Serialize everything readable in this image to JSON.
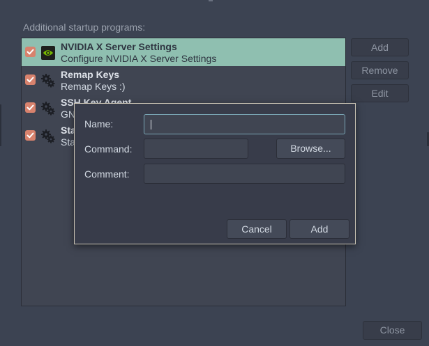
{
  "window": {
    "section_label": "Additional startup programs:",
    "buttons": {
      "add": "Add",
      "remove": "Remove",
      "edit": "Edit",
      "close": "Close"
    }
  },
  "programs": [
    {
      "title": "NVIDIA X Server Settings",
      "subtitle": "Configure NVIDIA X Server Settings",
      "checked": true,
      "selected": true,
      "icon": "nvidia-icon"
    },
    {
      "title": "Remap Keys",
      "subtitle": "Remap Keys :)",
      "checked": true,
      "selected": false,
      "icon": "gears-icon"
    },
    {
      "title": "SSH Key Agent",
      "subtitle": "GN",
      "checked": true,
      "selected": false,
      "icon": "gears-icon"
    },
    {
      "title": "Sta",
      "subtitle": "Sta",
      "checked": true,
      "selected": false,
      "icon": "gears-icon"
    }
  ],
  "dialog": {
    "name_label": "Name:",
    "name_value": "",
    "command_label": "Command:",
    "command_value": "",
    "browse_label": "Browse...",
    "comment_label": "Comment:",
    "comment_value": "",
    "cancel_label": "Cancel",
    "add_label": "Add"
  },
  "colors": {
    "background": "#3c4352",
    "selection": "#8fbfb0",
    "checkbox": "#d8826d",
    "focus_ring": "#7aa6b5",
    "nvidia_green": "#76b900"
  }
}
